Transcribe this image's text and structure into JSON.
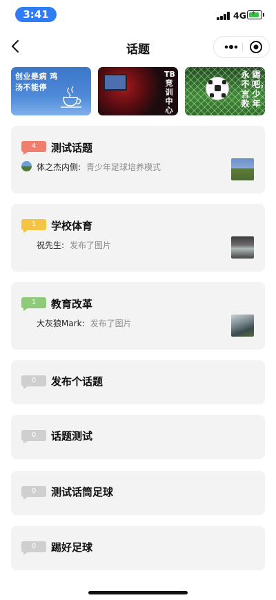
{
  "status_bar": {
    "time": "3:41",
    "network": "4G",
    "signal_icon": "signal-bars-icon",
    "battery_icon": "battery-charging-icon",
    "battery_level": 0.7
  },
  "nav": {
    "title": "话题",
    "back_icon": "chevron-left-icon",
    "more_icon": "more-dots-icon",
    "close_icon": "target-circle-icon"
  },
  "banners": [
    {
      "caption": "创业是病 鸡汤不能停",
      "icon": "coffee-cup-icon"
    },
    {
      "caption": "TB竞训中心",
      "icon": "stage-photo"
    },
    {
      "caption_lines": [
        "踢吧，少年",
        "永不言败"
      ],
      "icon": "soccer-ball-icon"
    }
  ],
  "colors": {
    "badge_red": "#f07e6e",
    "badge_yellow": "#f5c445",
    "badge_green": "#8fc97a",
    "badge_gray": "#cfcfcf",
    "card_bg": "#f3f3f3",
    "time_pill": "#2f7cf6"
  },
  "topics": [
    {
      "count": "4",
      "title": "测试话题",
      "author": "体之杰内侧:",
      "content": "青少年足球培养模式",
      "has_avatar": true,
      "has_thumb": true,
      "badge_color": "red"
    },
    {
      "count": "1",
      "title": "学校体育",
      "author": "祝先生:",
      "content": "发布了图片",
      "has_avatar": false,
      "has_thumb": true,
      "badge_color": "yellow"
    },
    {
      "count": "1",
      "title": "教育改革",
      "author": "大灰狼Mark:",
      "content": "发布了图片",
      "has_avatar": false,
      "has_thumb": true,
      "badge_color": "green"
    },
    {
      "count": "0",
      "title": "发布个话题",
      "badge_color": "gray"
    },
    {
      "count": "0",
      "title": "话题测试",
      "badge_color": "gray"
    },
    {
      "count": "0",
      "title": "测试话筒足球",
      "badge_color": "gray"
    },
    {
      "count": "0",
      "title": "踢好足球",
      "badge_color": "gray"
    }
  ]
}
